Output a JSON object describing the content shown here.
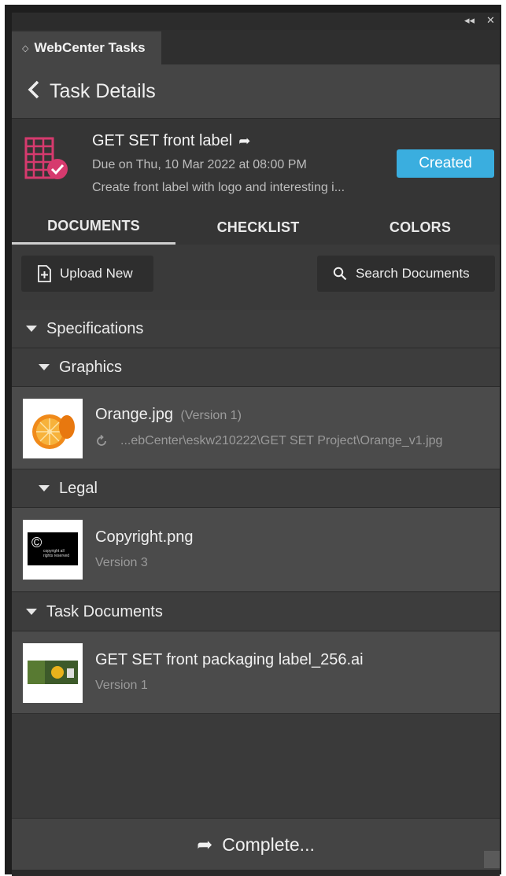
{
  "window": {
    "collapse_icon": "◂◂",
    "close_icon": "✕"
  },
  "panel_tab": {
    "caret": "◇",
    "label": "WebCenter Tasks"
  },
  "header": {
    "back_icon": "chevron-left-icon",
    "title": "Task Details"
  },
  "task": {
    "name": "GET SET front label",
    "due": "Due on Thu, 10 Mar 2022 at 08:00 PM",
    "description": "Create front label with logo and interesting i...",
    "status": "Created",
    "status_color": "#3aaedf",
    "icon_color": "#d63a6e"
  },
  "tabs": [
    "DOCUMENTS",
    "CHECKLIST",
    "COLORS"
  ],
  "active_tab": "DOCUMENTS",
  "toolbar": {
    "upload_label": "Upload New",
    "search_label": "Search Documents"
  },
  "tree": {
    "specifications": "Specifications",
    "graphics": "Graphics",
    "legal": "Legal",
    "task_documents": "Task Documents"
  },
  "documents": [
    {
      "name": "Orange.jpg",
      "version": "(Version 1)",
      "path": "...ebCenter\\eskw210222\\GET SET Project\\Orange_v1.jpg"
    },
    {
      "name": "Copyright.png",
      "version": "Version 3",
      "thumb_text": "copyright all rights reserved"
    },
    {
      "name": "GET SET front packaging label_256.ai",
      "version": "Version 1"
    }
  ],
  "footer": {
    "complete_label": "Complete..."
  }
}
